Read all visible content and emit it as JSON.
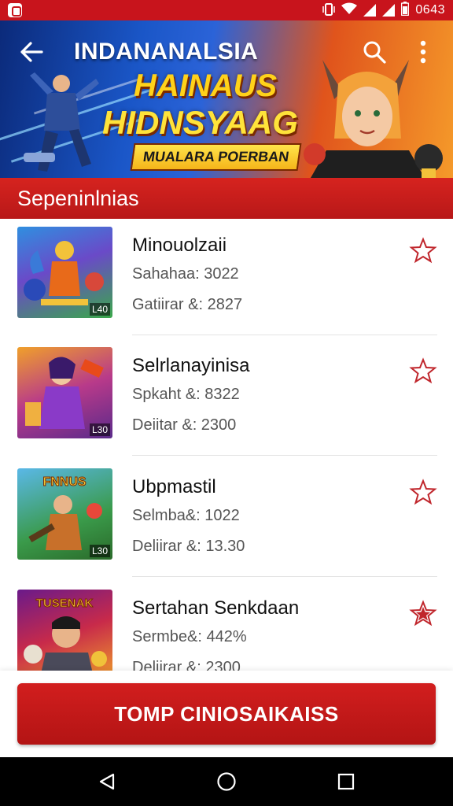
{
  "status_bar": {
    "time": "0643",
    "icons": [
      "notification-icon",
      "vibrate-icon",
      "wifi-icon",
      "signal-icon",
      "battery-icon"
    ]
  },
  "app_bar": {
    "title": "INDANANALSIA",
    "back_icon": "arrow-left-icon",
    "search_icon": "search-icon",
    "more_icon": "more-vert-icon"
  },
  "banner": {
    "line1": "HAINAUS",
    "line2": "HIDNSYAAG",
    "badge": "MUALARA POERBAN"
  },
  "section": {
    "title": "Sepeninlnias"
  },
  "items": [
    {
      "title": "Minouolzaii",
      "line1": "Sahahaa: 3022",
      "line2": "Gatiirar &: 2827",
      "tag": "L40",
      "favorited": false
    },
    {
      "title": "Selrlanayinisa",
      "line1": "Spkaht &: 8322",
      "line2": "Deiitar &: 2300",
      "tag": "L30",
      "favorited": false
    },
    {
      "title": "Ubpmastil",
      "line1": "Selmba&: 1022",
      "line2": "Deliirar &: 13.30",
      "tag": "L30",
      "favorited": false
    },
    {
      "title": "Sertahan Senkdaan",
      "line1": "Sermbe&: 442%",
      "line2": "Deliirar &: 2300",
      "tag": "",
      "favorited": true
    }
  ],
  "thumb_labels": {
    "item3": "FNNUS",
    "item4": "TUSENAK"
  },
  "cta": {
    "label": "TOMP CINIOSAIKAISS"
  },
  "nav": {
    "back_icon": "nav-back-icon",
    "home_icon": "nav-home-icon",
    "recents_icon": "nav-recents-icon"
  },
  "colors": {
    "primary_red": "#c8141c",
    "star_outline": "#c0262c",
    "star_filled": "#c0262c"
  }
}
